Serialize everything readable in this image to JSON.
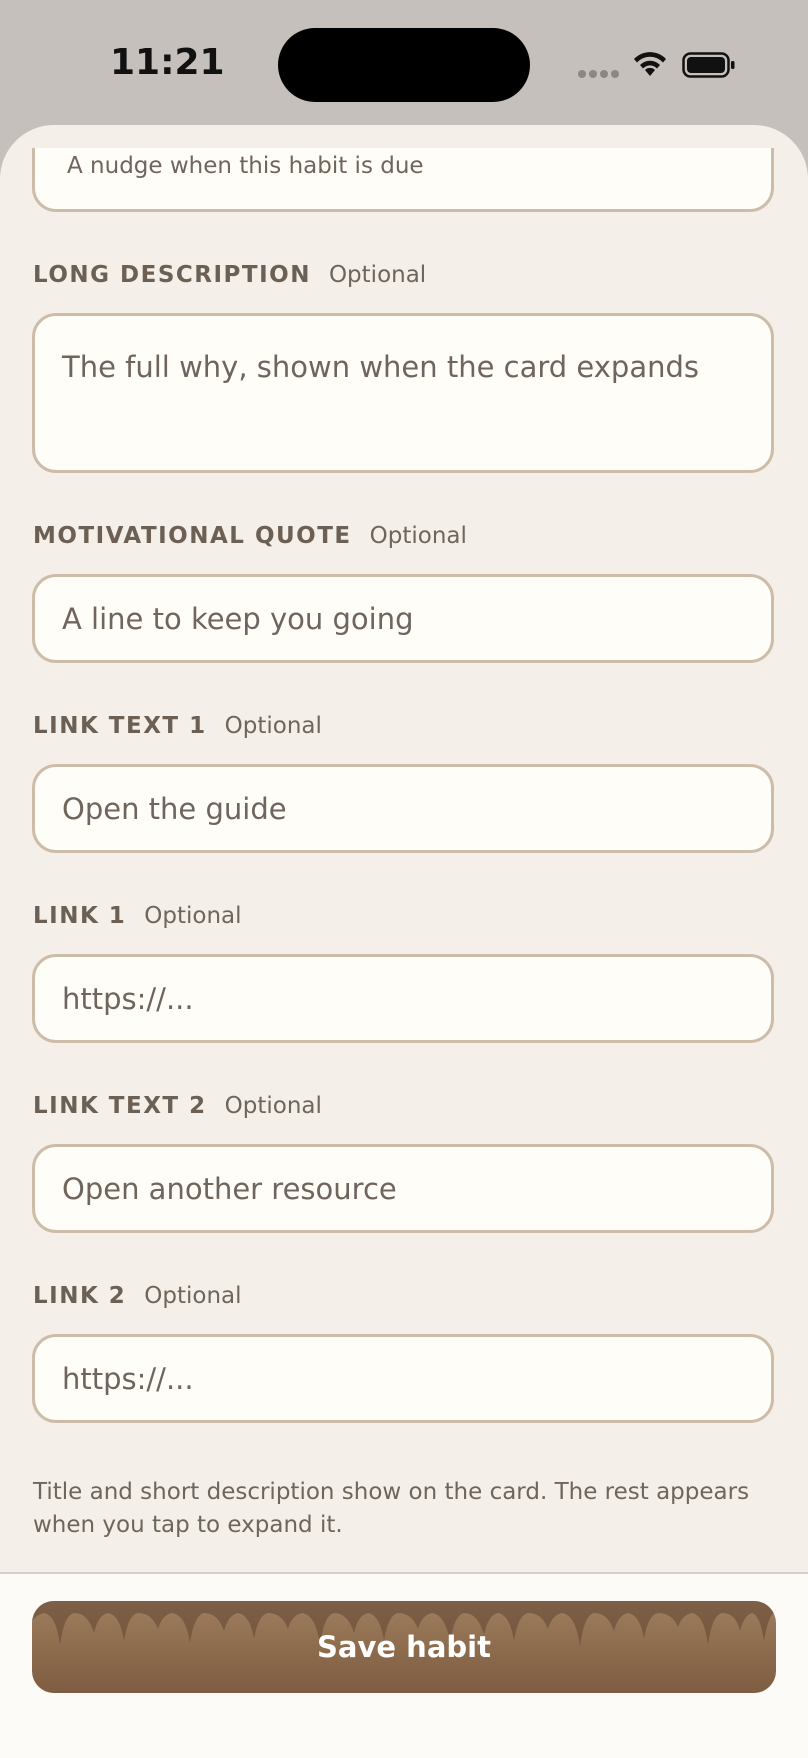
{
  "status_bar": {
    "time": "11:21",
    "icons": [
      "cellular-signal-icon",
      "wifi-icon",
      "battery-icon"
    ]
  },
  "form": {
    "reminder": {
      "placeholder": "A nudge when this habit is due"
    },
    "long_description": {
      "label": "LONG DESCRIPTION",
      "optional": "Optional",
      "placeholder": "The full why, shown when the card expands"
    },
    "motivational_quote": {
      "label": "MOTIVATIONAL QUOTE",
      "optional": "Optional",
      "placeholder": "A line to keep you going"
    },
    "link_text_1": {
      "label": "LINK TEXT 1",
      "optional": "Optional",
      "placeholder": "Open the guide"
    },
    "link_1": {
      "label": "LINK 1",
      "optional": "Optional",
      "placeholder": "https://..."
    },
    "link_text_2": {
      "label": "LINK TEXT 2",
      "optional": "Optional",
      "placeholder": "Open another resource"
    },
    "link_2": {
      "label": "LINK 2",
      "optional": "Optional",
      "placeholder": "https://..."
    },
    "helper_text": "Title and short description show on the card. The rest appears when you tap to expand it."
  },
  "footer": {
    "save_label": "Save habit"
  },
  "colors": {
    "sheet_background": "#f4efe8",
    "field_background": "#fffdf8",
    "field_border": "#cdbda8",
    "label_text": "#6c5f53",
    "placeholder_text": "#6f655b",
    "button_brown": "#8c6a4c"
  }
}
